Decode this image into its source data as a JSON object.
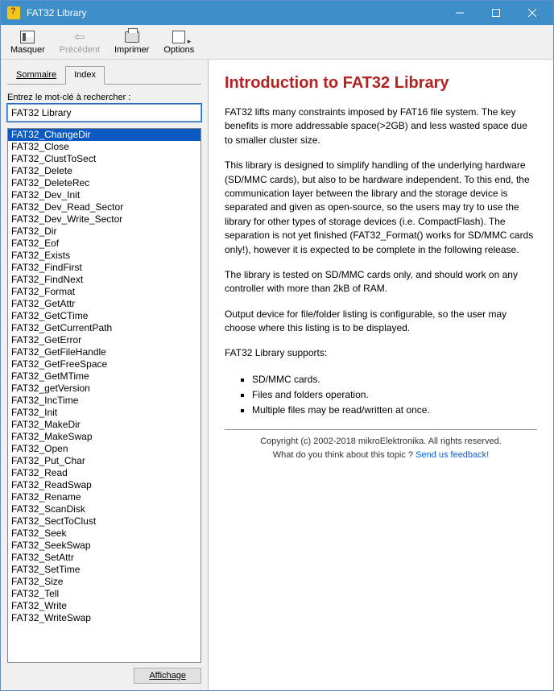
{
  "window": {
    "title": "FAT32 Library"
  },
  "toolbar": {
    "hide": "Masquer",
    "back": "Précédent",
    "print": "Imprimer",
    "options": "Options"
  },
  "tabs": {
    "summary": "Sommaire",
    "index": "Index"
  },
  "search": {
    "label": "Entrez le mot-clé à rechercher :",
    "value": "FAT32 Library"
  },
  "index_items": [
    "FAT32_ChangeDir",
    "FAT32_Close",
    "FAT32_ClustToSect",
    "FAT32_Delete",
    "FAT32_DeleteRec",
    "FAT32_Dev_Init",
    "FAT32_Dev_Read_Sector",
    "FAT32_Dev_Write_Sector",
    "FAT32_Dir",
    "FAT32_Eof",
    "FAT32_Exists",
    "FAT32_FindFirst",
    "FAT32_FindNext",
    "FAT32_Format",
    "FAT32_GetAttr",
    "FAT32_GetCTime",
    "FAT32_GetCurrentPath",
    "FAT32_GetError",
    "FAT32_GetFileHandle",
    "FAT32_GetFreeSpace",
    "FAT32_GetMTime",
    "FAT32_getVersion",
    "FAT32_IncTime",
    "FAT32_Init",
    "FAT32_MakeDir",
    "FAT32_MakeSwap",
    "FAT32_Open",
    "FAT32_Put_Char",
    "FAT32_Read",
    "FAT32_ReadSwap",
    "FAT32_Rename",
    "FAT32_ScanDisk",
    "FAT32_SectToClust",
    "FAT32_Seek",
    "FAT32_SeekSwap",
    "FAT32_SetAttr",
    "FAT32_SetTime",
    "FAT32_Size",
    "FAT32_Tell",
    "FAT32_Write",
    "FAT32_WriteSwap"
  ],
  "selected_index": 0,
  "display_button": "Affichage",
  "content": {
    "title": "Introduction to FAT32 Library",
    "p1": "FAT32 lifts many constraints imposed by FAT16 file system. The key benefits is more addressable space(>2GB) and less wasted space due to smaller cluster size.",
    "p2": "This library is designed to simplify handling of the underlying hardware (SD/MMC cards), but also to be hardware independent. To this end, the communication layer between the library and the storage device is separated and given as open-source, so the users may try to use the library for other types of storage devices (i.e. CompactFlash). The separation is not yet finished (FAT32_Format() works for SD/MMC cards only!), however it is expected to be complete in the following release.",
    "p3": "The library is tested on SD/MMC cards only, and should work on any controller with more than 2kB of RAM.",
    "p4": "Output device for file/folder listing is configurable, so the user may choose where this listing is to be displayed.",
    "p5": "FAT32 Library supports:",
    "bullets": [
      "SD/MMC cards.",
      "Files and folders operation.",
      "Multiple files may be read/written at once."
    ],
    "copyright": "Copyright (c) 2002-2018 mikroElektronika. All rights reserved.",
    "feedback_prompt": "What do you think about this topic ? ",
    "feedback_link": "Send us feedback!"
  }
}
